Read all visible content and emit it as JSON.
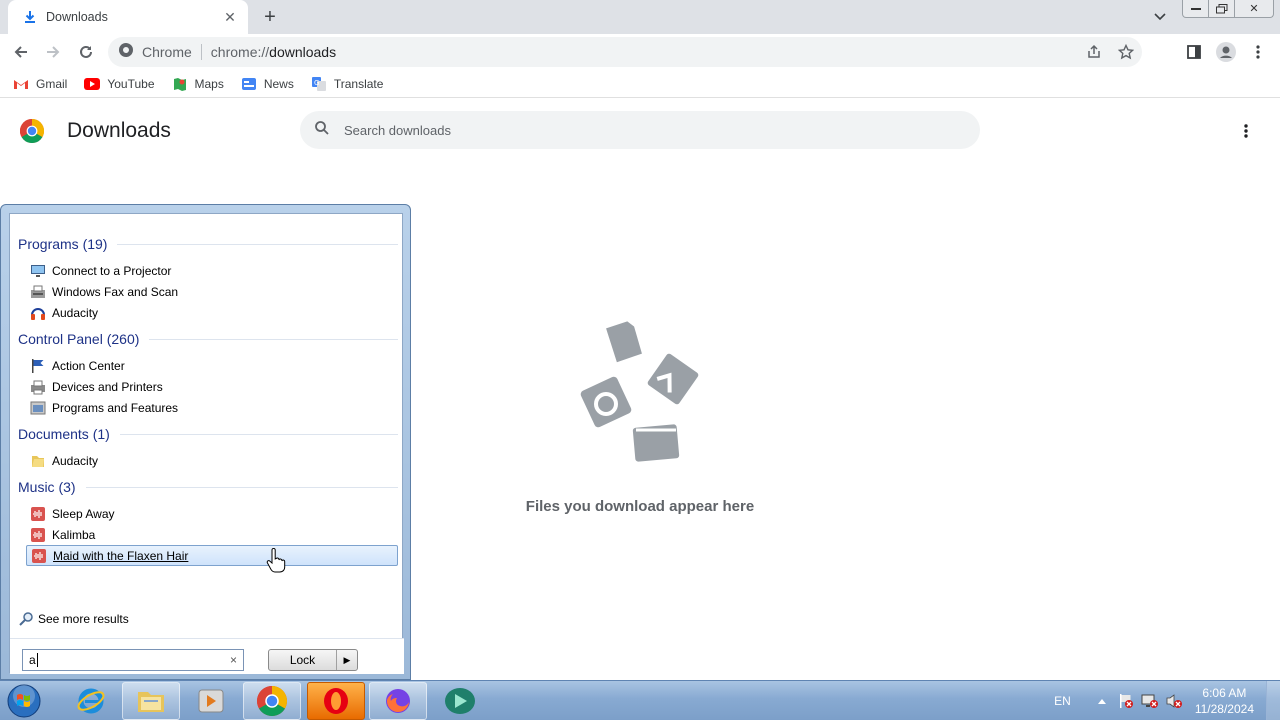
{
  "browser": {
    "tab": {
      "title": "Downloads"
    },
    "omnibox": {
      "site_label": "Chrome",
      "url_scheme": "chrome://",
      "url_host": "downloads"
    },
    "bookmarks": [
      {
        "label": "Gmail",
        "icon": "gmail-icon"
      },
      {
        "label": "YouTube",
        "icon": "youtube-icon"
      },
      {
        "label": "Maps",
        "icon": "maps-icon"
      },
      {
        "label": "News",
        "icon": "news-icon"
      },
      {
        "label": "Translate",
        "icon": "translate-icon"
      }
    ]
  },
  "downloads_page": {
    "title": "Downloads",
    "search_placeholder": "Search downloads",
    "empty_message": "Files you download appear here"
  },
  "start_menu": {
    "groups": [
      {
        "label": "Programs (19)",
        "items": [
          {
            "label": "Connect to a Projector",
            "icon": "projector-icon"
          },
          {
            "label": "Windows Fax and Scan",
            "icon": "fax-icon"
          },
          {
            "label": "Audacity",
            "icon": "headphones-icon"
          }
        ]
      },
      {
        "label": "Control Panel (260)",
        "items": [
          {
            "label": "Action Center",
            "icon": "flag-icon"
          },
          {
            "label": "Devices and Printers",
            "icon": "printer-icon"
          },
          {
            "label": "Programs and Features",
            "icon": "programs-icon"
          }
        ]
      },
      {
        "label": "Documents (1)",
        "items": [
          {
            "label": "Audacity",
            "icon": "folder-icon"
          }
        ]
      },
      {
        "label": "Music (3)",
        "items": [
          {
            "label": "Sleep Away",
            "icon": "audio-file-icon"
          },
          {
            "label": "Kalimba",
            "icon": "audio-file-icon"
          },
          {
            "label": "Maid with the Flaxen Hair",
            "icon": "audio-file-icon",
            "selected": true
          }
        ]
      }
    ],
    "see_more": "See more results",
    "search_value": "a",
    "clear_label": "×",
    "lock_label": "Lock"
  },
  "taskbar": {
    "language": "EN",
    "time": "6:06 AM",
    "date": "11/28/2024",
    "apps": [
      "internet-explorer-icon",
      "file-explorer-icon",
      "media-player-icon",
      "chrome-icon",
      "opera-icon",
      "firefox-icon",
      "camtasia-icon"
    ]
  },
  "colors": {
    "accent_blue": "#1e3287",
    "taskbar": "#88aad2",
    "selection": "#cfe3fb"
  }
}
